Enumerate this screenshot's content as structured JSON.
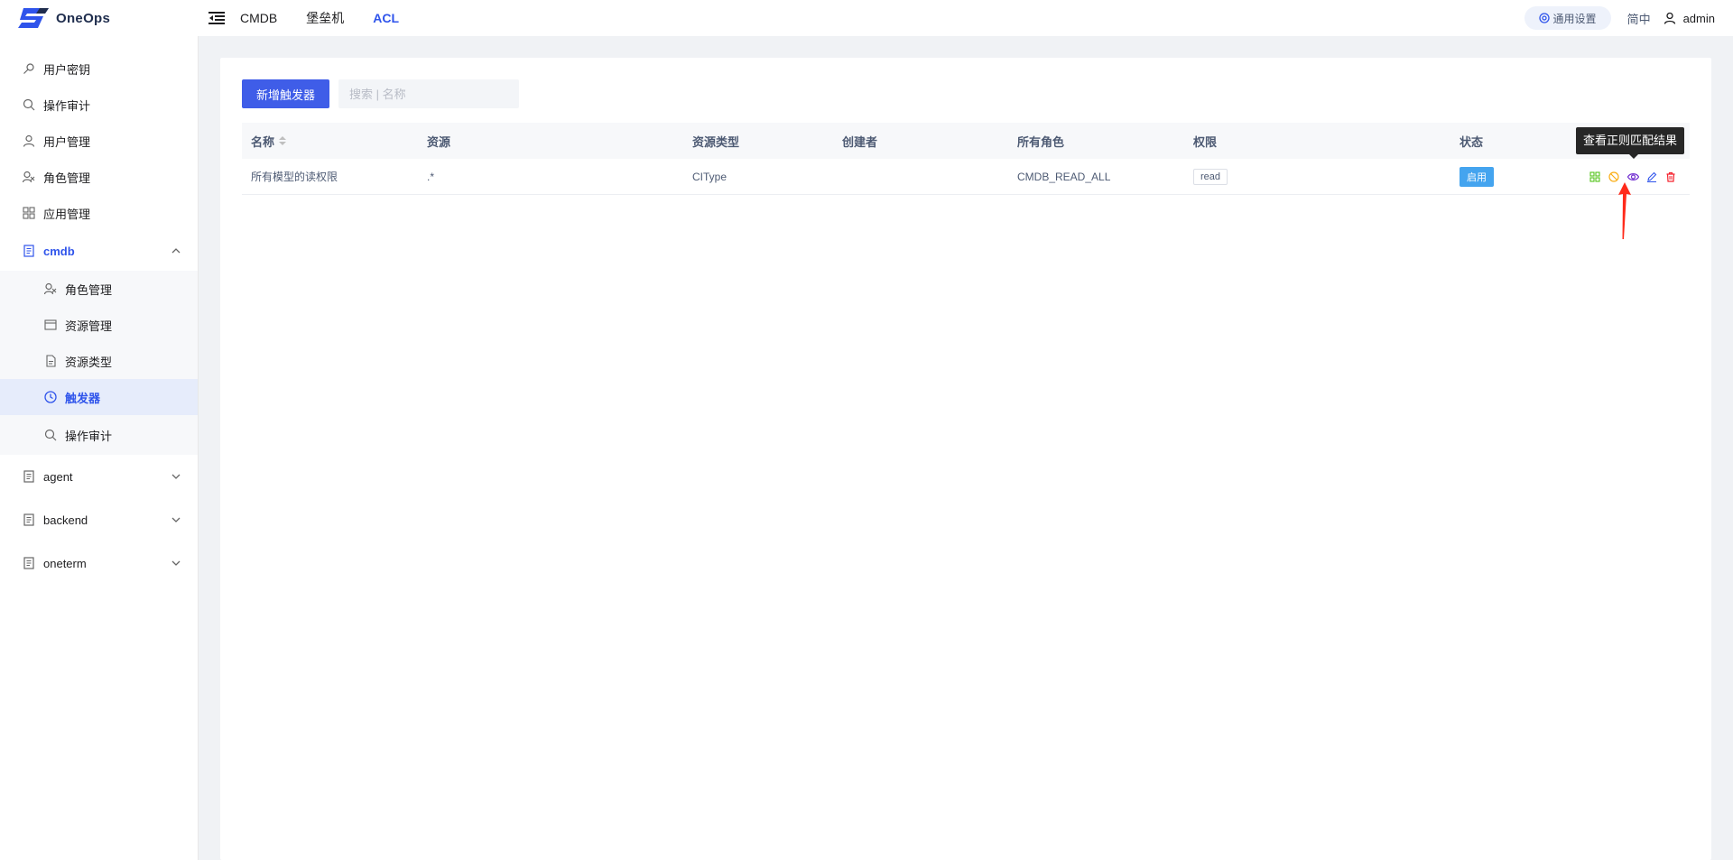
{
  "app": {
    "brand": "OneOps",
    "colors": {
      "accent": "#2f54eb",
      "primary_button": "#3f5de8",
      "status": "#44a4ef",
      "tooltip_bg": "#262626"
    }
  },
  "header": {
    "menu_toggle_icon": "indent-icon",
    "nav": [
      {
        "label": "CMDB"
      },
      {
        "label": "堡垒机"
      },
      {
        "label": "ACL",
        "active": true
      }
    ],
    "settings_label": "通用设置",
    "language": "简中",
    "user": "admin"
  },
  "sidebar": {
    "items": [
      {
        "label": "用户密钥",
        "icon": "key-icon"
      },
      {
        "label": "操作审计",
        "icon": "search-icon"
      },
      {
        "label": "用户管理",
        "icon": "user-icon"
      },
      {
        "label": "角色管理",
        "icon": "role-icon"
      },
      {
        "label": "应用管理",
        "icon": "apps-icon"
      }
    ],
    "groups": [
      {
        "label": "cmdb",
        "open": true,
        "icon": "document-icon",
        "children": [
          {
            "label": "角色管理",
            "icon": "role-icon"
          },
          {
            "label": "资源管理",
            "icon": "resource-icon"
          },
          {
            "label": "资源类型",
            "icon": "file-icon"
          },
          {
            "label": "触发器",
            "icon": "clock-icon",
            "active": true
          },
          {
            "label": "操作审计",
            "icon": "search-icon"
          }
        ]
      },
      {
        "label": "agent",
        "icon": "document-icon"
      },
      {
        "label": "backend",
        "icon": "document-icon"
      },
      {
        "label": "oneterm",
        "icon": "document-icon"
      }
    ]
  },
  "main": {
    "add_button": "新增触发器",
    "search_placeholder": "搜索 | 名称",
    "columns": [
      "名称",
      "资源",
      "资源类型",
      "创建者",
      "所有角色",
      "权限",
      "状态"
    ],
    "rows": [
      {
        "name": "所有模型的读权限",
        "resource": ".*",
        "resource_type": "CIType",
        "creator": "",
        "roles": "CMDB_READ_ALL",
        "permission": "read",
        "status": "启用"
      }
    ],
    "row_actions": [
      "grid-icon",
      "disable-icon",
      "eye-icon",
      "edit-icon",
      "delete-icon"
    ],
    "tooltip": "查看正则匹配结果"
  }
}
